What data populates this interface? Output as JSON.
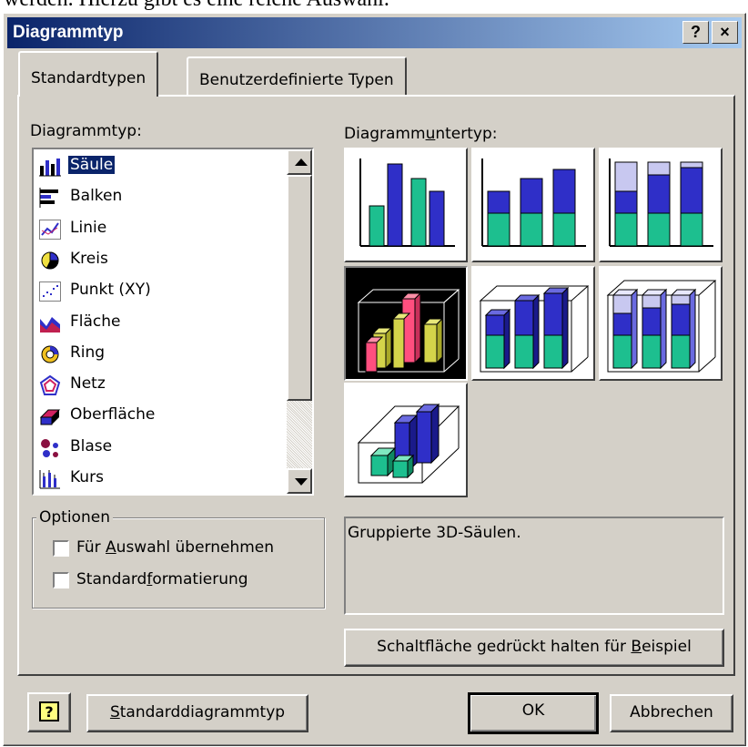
{
  "background_text": "werden. Hierzu gibt es eine reiche Auswahl.",
  "window": {
    "title": "Diagrammtyp",
    "help_button": "?",
    "close_button": "×"
  },
  "tabs": [
    {
      "label": "Standardtypen",
      "active": true
    },
    {
      "label": "Benutzerdefinierte Typen",
      "active": false
    }
  ],
  "chart_type_label": "Diagrammtyp:",
  "chart_types": [
    {
      "label": "Säule",
      "icon": "column-chart-icon",
      "selected": true
    },
    {
      "label": "Balken",
      "icon": "bar-chart-icon"
    },
    {
      "label": "Linie",
      "icon": "line-chart-icon"
    },
    {
      "label": "Kreis",
      "icon": "pie-chart-icon"
    },
    {
      "label": "Punkt (XY)",
      "icon": "scatter-chart-icon"
    },
    {
      "label": "Fläche",
      "icon": "area-chart-icon"
    },
    {
      "label": "Ring",
      "icon": "doughnut-chart-icon"
    },
    {
      "label": "Netz",
      "icon": "radar-chart-icon"
    },
    {
      "label": "Oberfläche",
      "icon": "surface-chart-icon"
    },
    {
      "label": "Blase",
      "icon": "bubble-chart-icon"
    },
    {
      "label": "Kurs",
      "icon": "stock-chart-icon"
    }
  ],
  "options": {
    "legend": "Optionen",
    "apply_to_selection": {
      "prefix": "Für ",
      "accel": "A",
      "suffix": "uswahl übernehmen",
      "checked": false
    },
    "default_formatting": {
      "prefix": "Standard",
      "accel": "f",
      "suffix": "ormatierung",
      "checked": false
    }
  },
  "subtype": {
    "label_prefix": "Diagramm",
    "label_accel": "u",
    "label_suffix": "ntertyp:",
    "items": [
      {
        "name": "clustered-column",
        "selected": false
      },
      {
        "name": "stacked-column",
        "selected": false
      },
      {
        "name": "100-stacked-column",
        "selected": false
      },
      {
        "name": "clustered-column-3d-effect",
        "selected": true
      },
      {
        "name": "stacked-column-3d-effect",
        "selected": false
      },
      {
        "name": "100-stacked-column-3d-effect",
        "selected": false
      },
      {
        "name": "3d-column",
        "selected": false
      }
    ],
    "description": "Gruppierte 3D-Säulen."
  },
  "buttons": {
    "preview": {
      "prefix": "Schaltfläche gedrückt halten für ",
      "accel": "B",
      "suffix": "eispiel"
    },
    "office_assistant": "?",
    "default_chart": {
      "prefix": "",
      "accel": "S",
      "suffix": "tandarddiagrammtyp"
    },
    "ok": "OK",
    "cancel": "Abbrechen"
  },
  "colors": {
    "title_start": "#0a246a",
    "title_end": "#a6caf0",
    "face": "#d4d0c8",
    "bar_blue": "#2f2fc8",
    "bar_teal": "#1dbf8f",
    "bar_pale": "#c8c8f0",
    "bar_pink": "#ff4f7f",
    "bar_yellow": "#d4d44a"
  }
}
